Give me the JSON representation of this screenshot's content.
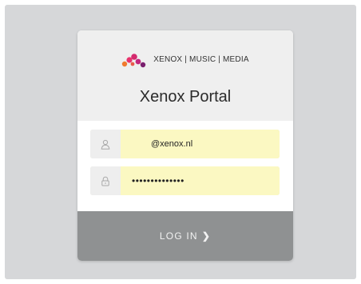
{
  "brand": {
    "logo_text": "XENOX | MUSIC | MEDIA",
    "logo_colors": [
      "#e8336c",
      "#c2267d",
      "#f07a2e",
      "#7a1f6e"
    ]
  },
  "portal": {
    "title": "Xenox Portal"
  },
  "form": {
    "username": {
      "icon": "user-icon",
      "value": "@xenox.nl"
    },
    "password": {
      "icon": "lock-icon",
      "value": "••••••••••••••"
    },
    "login_label": "LOG IN",
    "login_chevron": "❯"
  },
  "colors": {
    "background": "#d6d7d9",
    "header": "#efefef",
    "autofill": "#fbf8c2",
    "button": "#8f9192"
  }
}
